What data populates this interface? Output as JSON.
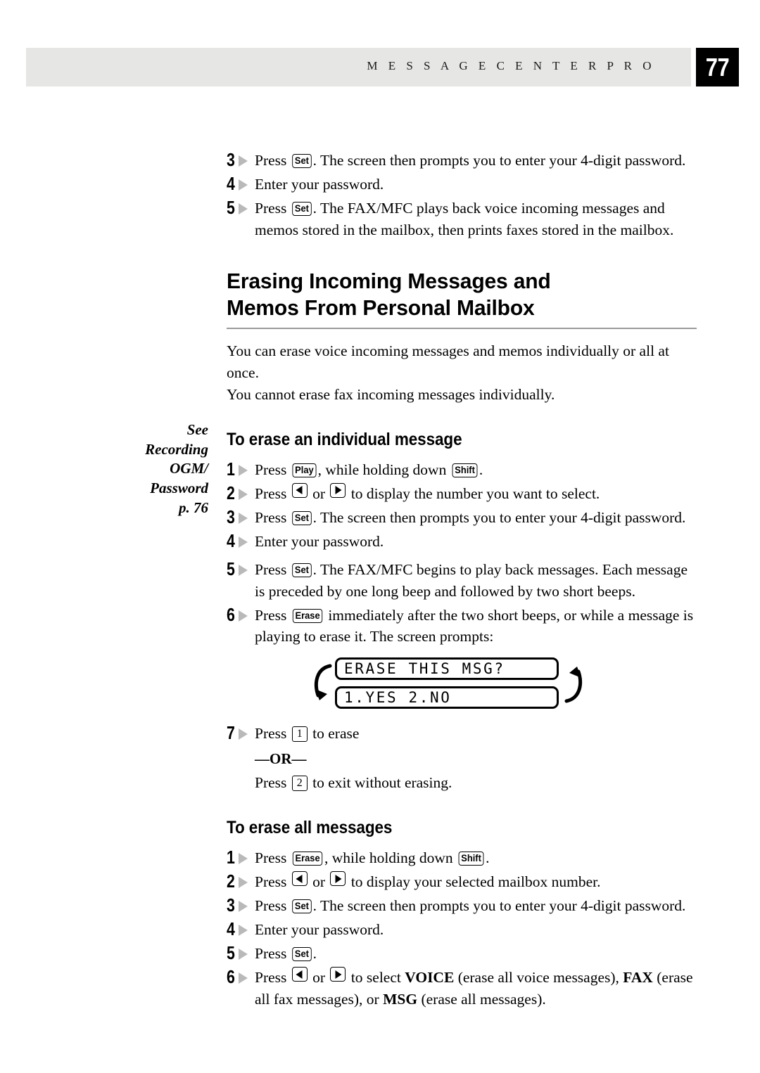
{
  "header": {
    "title": "M E S S A G E   C E N T E R   P R O",
    "page_number": "77"
  },
  "margin_note": {
    "line1": "See",
    "line2": "Recording",
    "line3": "OGM/",
    "line4": "Password",
    "line5": "p. 76"
  },
  "top_steps": [
    {
      "number": "3",
      "pre": "Press ",
      "key": "Set",
      "post": ".  The screen then prompts you to enter your  4-digit password."
    },
    {
      "number": "4",
      "pre": "Enter your password.",
      "key": "",
      "post": ""
    },
    {
      "number": "5",
      "pre": "Press ",
      "key": "Set",
      "post": ".  The FAX/MFC plays back voice incoming messages and memos stored in the mailbox, then prints faxes stored in the mailbox."
    }
  ],
  "main_heading": {
    "line1": "Erasing Incoming Messages and",
    "line2": "Memos From Personal Mailbox"
  },
  "intro": {
    "line1": "You can erase voice incoming messages and memos individually or all at once.",
    "line2": "You cannot erase fax incoming messages individually."
  },
  "section_individual": {
    "heading": "To erase an individual message",
    "steps": {
      "s1_num": "1",
      "s1_a": "Press ",
      "s1_key1": "Play",
      "s1_b": ", while holding down ",
      "s1_key2": "Shift",
      "s1_c": ".",
      "s2_num": "2",
      "s2_a": "Press ",
      "s2_b": " or ",
      "s2_c": " to display the number you want to select.",
      "s3_num": "3",
      "s3_a": "Press ",
      "s3_key": "Set",
      "s3_b": ".  The screen then prompts you to enter your 4-digit password.",
      "s4_num": "4",
      "s4_a": "Enter your password.",
      "s5_num": "5",
      "s5_a": "Press ",
      "s5_key": "Set",
      "s5_b": ".  The FAX/MFC begins to play back messages.  Each message is preceded by one long beep and followed by two short beeps.",
      "s6_num": "6",
      "s6_a": "Press ",
      "s6_key": "Erase",
      "s6_b": " immediately after the two short beeps, or while a message is playing to erase it.  The screen prompts:",
      "s7_num": "7",
      "s7_a": "Press ",
      "s7_key": "1",
      "s7_b": " to erase"
    },
    "lcd": {
      "line1": "ERASE THIS MSG?",
      "line2": "1.YES 2.NO"
    },
    "or_divider": "—OR—",
    "alt": {
      "a": "Press ",
      "key": "2",
      "b": " to exit without erasing."
    }
  },
  "section_all": {
    "heading": "To erase all messages",
    "steps": {
      "s1_num": "1",
      "s1_a": "Press ",
      "s1_key1": "Erase",
      "s1_b": ", while holding down ",
      "s1_key2": "Shift",
      "s1_c": ".",
      "s2_num": "2",
      "s2_a": "Press ",
      "s2_b": " or ",
      "s2_c": " to display your selected mailbox number.",
      "s3_num": "3",
      "s3_a": "Press ",
      "s3_key": "Set",
      "s3_b": ".  The screen then prompts you to enter your 4-digit password.",
      "s4_num": "4",
      "s4_a": "Enter your password.",
      "s5_num": "5",
      "s5_a": "Press ",
      "s5_key": "Set",
      "s5_b": ".",
      "s6_num": "6",
      "s6_a": "Press ",
      "s6_b": " or ",
      "s6_c": " to select ",
      "s6_bold1": "VOICE",
      "s6_d": " (erase all voice messages), ",
      "s6_bold2": "FAX",
      "s6_e": " (erase all fax messages), or ",
      "s6_bold3": "MSG",
      "s6_f": " (erase all messages)."
    }
  }
}
